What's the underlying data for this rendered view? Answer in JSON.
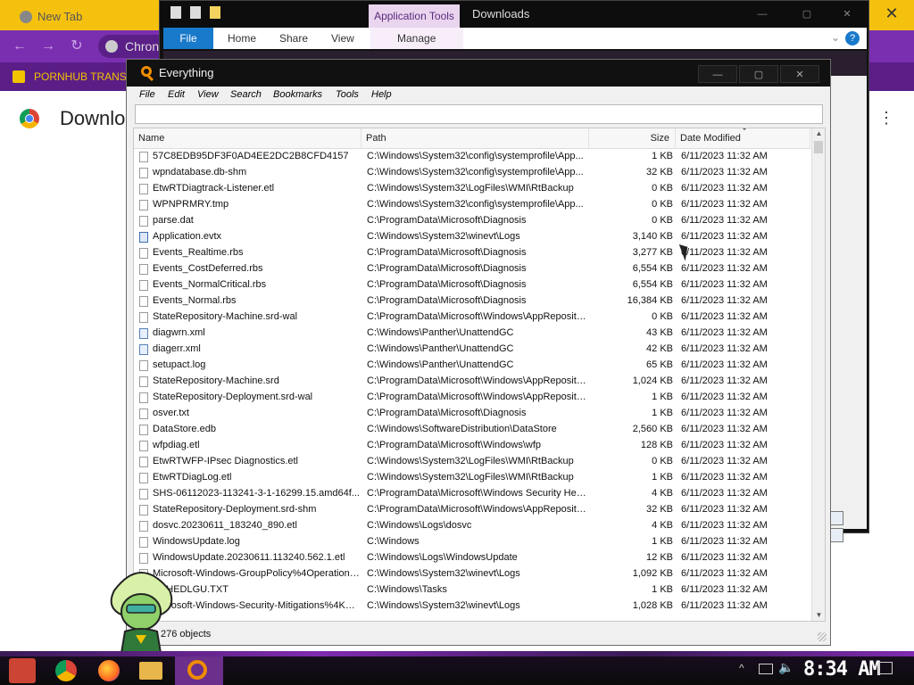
{
  "chrome": {
    "tab_title": "New Tab",
    "omnibox_text": "Chron",
    "bookmark_label": "PORNHUB TRANS",
    "page_title": "Downlo"
  },
  "explorer": {
    "app_tools": "Application Tools",
    "title": "Downloads",
    "ribbon": {
      "file": "File",
      "home": "Home",
      "share": "Share",
      "view": "View",
      "manage": "Manage"
    }
  },
  "everything": {
    "title": "Everything",
    "menu": [
      "File",
      "Edit",
      "View",
      "Search",
      "Bookmarks",
      "Tools",
      "Help"
    ],
    "search_value": "",
    "columns": {
      "name": "Name",
      "path": "Path",
      "size": "Size",
      "date": "Date Modified"
    },
    "rows": [
      {
        "icon": "file",
        "name": "57C8EDB95DF3F0AD4EE2DC2B8CFD4157",
        "path": "C:\\Windows\\System32\\config\\systemprofile\\App...",
        "size": "1 KB",
        "date": "6/11/2023 11:32 AM"
      },
      {
        "icon": "file",
        "name": "wpndatabase.db-shm",
        "path": "C:\\Windows\\System32\\config\\systemprofile\\App...",
        "size": "32 KB",
        "date": "6/11/2023 11:32 AM"
      },
      {
        "icon": "file",
        "name": "EtwRTDiagtrack-Listener.etl",
        "path": "C:\\Windows\\System32\\LogFiles\\WMI\\RtBackup",
        "size": "0 KB",
        "date": "6/11/2023 11:32 AM"
      },
      {
        "icon": "file",
        "name": "WPNPRMRY.tmp",
        "path": "C:\\Windows\\System32\\config\\systemprofile\\App...",
        "size": "0 KB",
        "date": "6/11/2023 11:32 AM"
      },
      {
        "icon": "file",
        "name": "parse.dat",
        "path": "C:\\ProgramData\\Microsoft\\Diagnosis",
        "size": "0 KB",
        "date": "6/11/2023 11:32 AM"
      },
      {
        "icon": "evtx",
        "name": "Application.evtx",
        "path": "C:\\Windows\\System32\\winevt\\Logs",
        "size": "3,140 KB",
        "date": "6/11/2023 11:32 AM"
      },
      {
        "icon": "file",
        "name": "Events_Realtime.rbs",
        "path": "C:\\ProgramData\\Microsoft\\Diagnosis",
        "size": "3,277 KB",
        "date": "6/11/2023 11:32 AM"
      },
      {
        "icon": "file",
        "name": "Events_CostDeferred.rbs",
        "path": "C:\\ProgramData\\Microsoft\\Diagnosis",
        "size": "6,554 KB",
        "date": "6/11/2023 11:32 AM"
      },
      {
        "icon": "file",
        "name": "Events_NormalCritical.rbs",
        "path": "C:\\ProgramData\\Microsoft\\Diagnosis",
        "size": "6,554 KB",
        "date": "6/11/2023 11:32 AM"
      },
      {
        "icon": "file",
        "name": "Events_Normal.rbs",
        "path": "C:\\ProgramData\\Microsoft\\Diagnosis",
        "size": "16,384 KB",
        "date": "6/11/2023 11:32 AM"
      },
      {
        "icon": "file",
        "name": "StateRepository-Machine.srd-wal",
        "path": "C:\\ProgramData\\Microsoft\\Windows\\AppRepository",
        "size": "0 KB",
        "date": "6/11/2023 11:32 AM"
      },
      {
        "icon": "xml",
        "name": "diagwrn.xml",
        "path": "C:\\Windows\\Panther\\UnattendGC",
        "size": "43 KB",
        "date": "6/11/2023 11:32 AM"
      },
      {
        "icon": "xml",
        "name": "diagerr.xml",
        "path": "C:\\Windows\\Panther\\UnattendGC",
        "size": "42 KB",
        "date": "6/11/2023 11:32 AM"
      },
      {
        "icon": "file",
        "name": "setupact.log",
        "path": "C:\\Windows\\Panther\\UnattendGC",
        "size": "65 KB",
        "date": "6/11/2023 11:32 AM"
      },
      {
        "icon": "file",
        "name": "StateRepository-Machine.srd",
        "path": "C:\\ProgramData\\Microsoft\\Windows\\AppRepository",
        "size": "1,024 KB",
        "date": "6/11/2023 11:32 AM"
      },
      {
        "icon": "file",
        "name": "StateRepository-Deployment.srd-wal",
        "path": "C:\\ProgramData\\Microsoft\\Windows\\AppRepository",
        "size": "1 KB",
        "date": "6/11/2023 11:32 AM"
      },
      {
        "icon": "file",
        "name": "osver.txt",
        "path": "C:\\ProgramData\\Microsoft\\Diagnosis",
        "size": "1 KB",
        "date": "6/11/2023 11:32 AM"
      },
      {
        "icon": "file",
        "name": "DataStore.edb",
        "path": "C:\\Windows\\SoftwareDistribution\\DataStore",
        "size": "2,560 KB",
        "date": "6/11/2023 11:32 AM"
      },
      {
        "icon": "file",
        "name": "wfpdiag.etl",
        "path": "C:\\ProgramData\\Microsoft\\Windows\\wfp",
        "size": "128 KB",
        "date": "6/11/2023 11:32 AM"
      },
      {
        "icon": "file",
        "name": "EtwRTWFP-IPsec Diagnostics.etl",
        "path": "C:\\Windows\\System32\\LogFiles\\WMI\\RtBackup",
        "size": "0 KB",
        "date": "6/11/2023 11:32 AM"
      },
      {
        "icon": "file",
        "name": "EtwRTDiagLog.etl",
        "path": "C:\\Windows\\System32\\LogFiles\\WMI\\RtBackup",
        "size": "1 KB",
        "date": "6/11/2023 11:32 AM"
      },
      {
        "icon": "file",
        "name": "SHS-06112023-113241-3-1-16299.15.amd64f...",
        "path": "C:\\ProgramData\\Microsoft\\Windows Security Heal...",
        "size": "4 KB",
        "date": "6/11/2023 11:32 AM"
      },
      {
        "icon": "file",
        "name": "StateRepository-Deployment.srd-shm",
        "path": "C:\\ProgramData\\Microsoft\\Windows\\AppRepository",
        "size": "32 KB",
        "date": "6/11/2023 11:32 AM"
      },
      {
        "icon": "file",
        "name": "dosvc.20230611_183240_890.etl",
        "path": "C:\\Windows\\Logs\\dosvc",
        "size": "4 KB",
        "date": "6/11/2023 11:32 AM"
      },
      {
        "icon": "file",
        "name": "WindowsUpdate.log",
        "path": "C:\\Windows",
        "size": "1 KB",
        "date": "6/11/2023 11:32 AM"
      },
      {
        "icon": "file",
        "name": "WindowsUpdate.20230611.113240.562.1.etl",
        "path": "C:\\Windows\\Logs\\WindowsUpdate",
        "size": "12 KB",
        "date": "6/11/2023 11:32 AM"
      },
      {
        "icon": "file",
        "name": "Microsoft-Windows-GroupPolicy%4Operational...",
        "path": "C:\\Windows\\System32\\winevt\\Logs",
        "size": "1,092 KB",
        "date": "6/11/2023 11:32 AM"
      },
      {
        "icon": "file",
        "name": "SCHEDLGU.TXT",
        "path": "C:\\Windows\\Tasks",
        "size": "1 KB",
        "date": "6/11/2023 11:32 AM"
      },
      {
        "icon": "file",
        "name": "Microsoft-Windows-Security-Mitigations%4Kern...",
        "path": "C:\\Windows\\System32\\winevt\\Logs",
        "size": "1,028 KB",
        "date": "6/11/2023 11:32 AM"
      }
    ],
    "status_text": "276 objects"
  },
  "taskbar": {
    "clock": "8:34 AM"
  },
  "colors": {
    "chrome_tabbar": "#f5c10f",
    "chrome_toolbar": "#7a2fb0",
    "explorer_file_tab": "#1979ca",
    "everything_icon": "#f08c00"
  }
}
